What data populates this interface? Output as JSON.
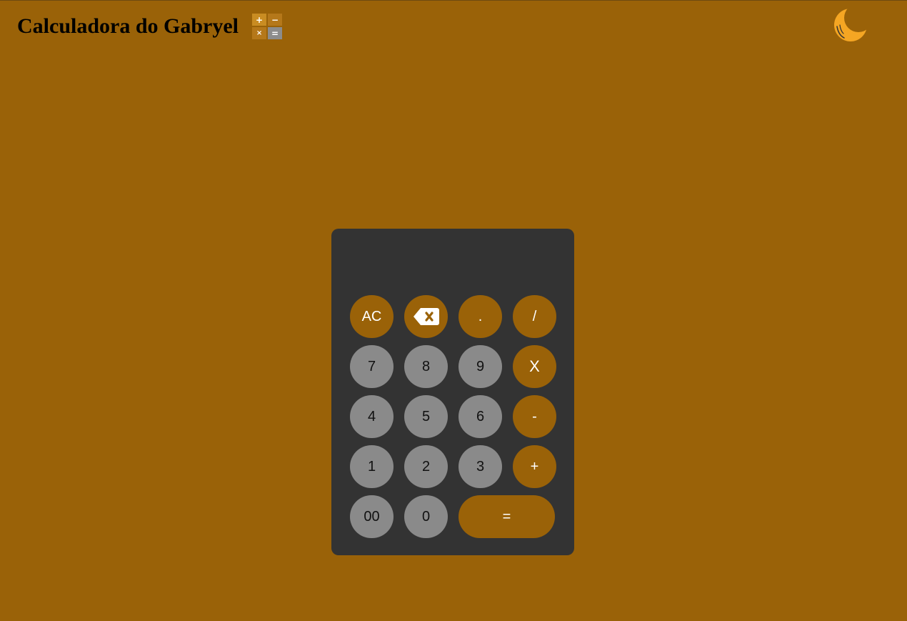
{
  "header": {
    "title": "Calculadora do Gabryel",
    "logo_symbols": [
      "+",
      "−",
      "×",
      "="
    ]
  },
  "theme_toggle": {
    "icon": "moon-icon"
  },
  "display": {
    "value": ""
  },
  "keypad": {
    "clear": "AC",
    "backspace_icon": "backspace-icon",
    "dot": ".",
    "divide": "/",
    "seven": "7",
    "eight": "8",
    "nine": "9",
    "multiply": "X",
    "four": "4",
    "five": "5",
    "six": "6",
    "minus": "-",
    "one": "1",
    "two": "2",
    "three": "3",
    "plus": "+",
    "double_zero": "00",
    "zero": "0",
    "equals": "="
  },
  "colors": {
    "background": "#9a6208",
    "calculator": "#333333",
    "number_key": "#8a8a8a",
    "operator_key": "#9a6208",
    "moon": "#f5a623"
  }
}
